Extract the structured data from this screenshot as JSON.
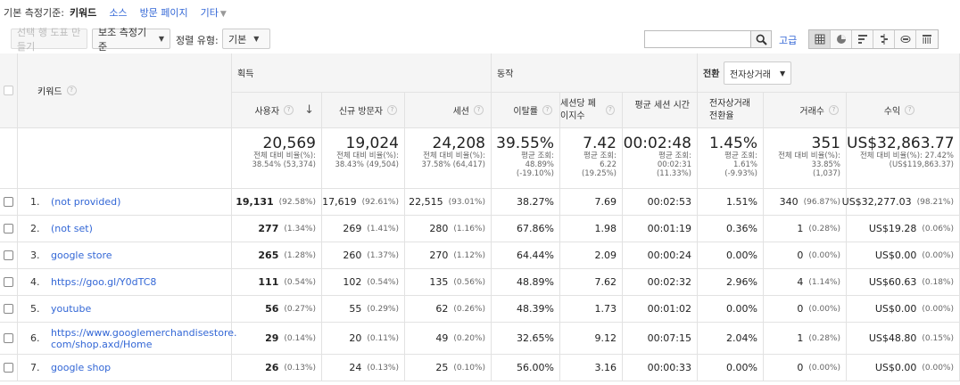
{
  "dimension_bar": {
    "label": "기본 측정기준:",
    "current": "키워드",
    "links": [
      "소스",
      "방문 페이지",
      "기타"
    ]
  },
  "toolbar": {
    "plot_rows": "선택 행 도표 만들기",
    "secondary_dim": "보조 측정기준",
    "sort_label": "정렬 유형:",
    "sort_value": "기본",
    "search_placeholder": "",
    "advanced": "고급"
  },
  "groups": {
    "acquisition": "획득",
    "behavior": "동작",
    "conversion": "전환",
    "conversion_select": "전자상거래"
  },
  "columns": {
    "keyword": "키워드",
    "users": "사용자",
    "new_users": "신규 방문자",
    "sessions": "세션",
    "bounce": "이탈률",
    "pages_session": "세션당 페이지수",
    "avg_duration": "평균 세션 시간",
    "conv_rate": "전자상거래 전환율",
    "transactions": "거래수",
    "revenue": "수익"
  },
  "totals": {
    "users": {
      "big": "20,569",
      "l1": "전체 대비 비율(%):",
      "l2": "38.54% (53,374)"
    },
    "new_users": {
      "big": "19,024",
      "l1": "전체 대비 비율(%):",
      "l2": "38.43% (49,504)"
    },
    "sessions": {
      "big": "24,208",
      "l1": "전체 대비 비율(%):",
      "l2": "37.58% (64,417)"
    },
    "bounce": {
      "big": "39.55%",
      "l1": "평균 조회:",
      "l2": "48.89%",
      "l3": "(-19.10%)"
    },
    "pages_session": {
      "big": "7.42",
      "l1": "평균 조회:",
      "l2": "6.22",
      "l3": "(19.25%)"
    },
    "avg_duration": {
      "big": "00:02:48",
      "l1": "평균 조회:",
      "l2": "00:02:31",
      "l3": "(11.33%)"
    },
    "conv_rate": {
      "big": "1.45%",
      "l1": "평균 조회:",
      "l2": "1.61%",
      "l3": "(-9.93%)"
    },
    "transactions": {
      "big": "351",
      "l1": "전체 대비 비율(%):",
      "l2": "33.85%",
      "l3": "(1,037)"
    },
    "revenue": {
      "big": "US$32,863.77",
      "l1": "전체 대비 비율(%): 27.42%",
      "l2": "(US$119,863.37)"
    }
  },
  "rows": [
    {
      "idx": "1.",
      "kw": "(not provided)",
      "users": "19,131",
      "users_p": "(92.58%)",
      "new": "17,619",
      "new_p": "(92.61%)",
      "sess": "22,515",
      "sess_p": "(93.01%)",
      "bounce": "38.27%",
      "pps": "7.69",
      "dur": "00:02:53",
      "cr": "1.51%",
      "tx": "340",
      "tx_p": "(96.87%)",
      "rev": "US$32,277.03",
      "rev_p": "(98.21%)"
    },
    {
      "idx": "2.",
      "kw": "(not set)",
      "users": "277",
      "users_p": "(1.34%)",
      "new": "269",
      "new_p": "(1.41%)",
      "sess": "280",
      "sess_p": "(1.16%)",
      "bounce": "67.86%",
      "pps": "1.98",
      "dur": "00:01:19",
      "cr": "0.36%",
      "tx": "1",
      "tx_p": "(0.28%)",
      "rev": "US$19.28",
      "rev_p": "(0.06%)"
    },
    {
      "idx": "3.",
      "kw": "google store",
      "users": "265",
      "users_p": "(1.28%)",
      "new": "260",
      "new_p": "(1.37%)",
      "sess": "270",
      "sess_p": "(1.12%)",
      "bounce": "64.44%",
      "pps": "2.09",
      "dur": "00:00:24",
      "cr": "0.00%",
      "tx": "0",
      "tx_p": "(0.00%)",
      "rev": "US$0.00",
      "rev_p": "(0.00%)"
    },
    {
      "idx": "4.",
      "kw": "https://goo.gl/Y0dTC8",
      "users": "111",
      "users_p": "(0.54%)",
      "new": "102",
      "new_p": "(0.54%)",
      "sess": "135",
      "sess_p": "(0.56%)",
      "bounce": "48.89%",
      "pps": "7.62",
      "dur": "00:02:32",
      "cr": "2.96%",
      "tx": "4",
      "tx_p": "(1.14%)",
      "rev": "US$60.63",
      "rev_p": "(0.18%)"
    },
    {
      "idx": "5.",
      "kw": "youtube",
      "users": "56",
      "users_p": "(0.27%)",
      "new": "55",
      "new_p": "(0.29%)",
      "sess": "62",
      "sess_p": "(0.26%)",
      "bounce": "48.39%",
      "pps": "1.73",
      "dur": "00:01:02",
      "cr": "0.00%",
      "tx": "0",
      "tx_p": "(0.00%)",
      "rev": "US$0.00",
      "rev_p": "(0.00%)"
    },
    {
      "idx": "6.",
      "kw": "https://www.googlemerchandisestore.com/shop.axd/Home",
      "kw1": "https://www.googlemerchandisestore.",
      "kw2": "com/shop.axd/Home",
      "users": "29",
      "users_p": "(0.14%)",
      "new": "20",
      "new_p": "(0.11%)",
      "sess": "49",
      "sess_p": "(0.20%)",
      "bounce": "32.65%",
      "pps": "9.12",
      "dur": "00:07:15",
      "cr": "2.04%",
      "tx": "1",
      "tx_p": "(0.28%)",
      "rev": "US$48.80",
      "rev_p": "(0.15%)"
    },
    {
      "idx": "7.",
      "kw": "google shop",
      "users": "26",
      "users_p": "(0.13%)",
      "new": "24",
      "new_p": "(0.13%)",
      "sess": "25",
      "sess_p": "(0.10%)",
      "bounce": "56.00%",
      "pps": "3.16",
      "dur": "00:00:33",
      "cr": "0.00%",
      "tx": "0",
      "tx_p": "(0.00%)",
      "rev": "US$0.00",
      "rev_p": "(0.00%)"
    }
  ]
}
